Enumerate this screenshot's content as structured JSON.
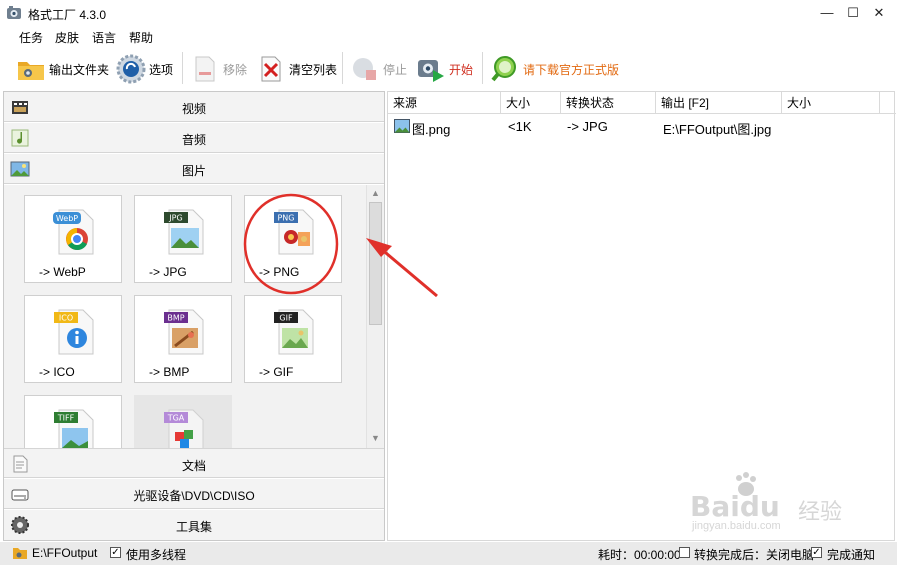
{
  "window": {
    "title": "格式工厂 4.3.0",
    "minimize_glyph": "—",
    "maximize_glyph": "☐",
    "close_glyph": "✕"
  },
  "menu": [
    "任务",
    "皮肤",
    "语言",
    "帮助"
  ],
  "toolbar": {
    "output_folder": "输出文件夹",
    "options": "选项",
    "remove": "移除",
    "clear_list": "清空列表",
    "stop": "停止",
    "start": "开始",
    "download": "请下载官方正式版"
  },
  "categories": {
    "video": "视频",
    "audio": "音频",
    "image": "图片",
    "document": "文档",
    "rom": "光驱设备\\DVD\\CD\\ISO",
    "tools": "工具集"
  },
  "formats": [
    {
      "badge": "WebP",
      "label": "-> WebP"
    },
    {
      "badge": "JPG",
      "label": "-> JPG"
    },
    {
      "badge": "PNG",
      "label": "-> PNG"
    },
    {
      "badge": "ICO",
      "label": "-> ICO"
    },
    {
      "badge": "BMP",
      "label": "-> BMP"
    },
    {
      "badge": "GIF",
      "label": "-> GIF"
    },
    {
      "badge": "TIFF",
      "label": ""
    },
    {
      "badge": "TGA",
      "label": ""
    }
  ],
  "table": {
    "headers": [
      "来源",
      "大小",
      "转换状态",
      "输出 [F2]",
      "大小"
    ],
    "rows": [
      {
        "source": "图.png",
        "size": "<1K",
        "status": "-> JPG",
        "output": "E:\\FFOutput\\图.jpg",
        "out_size": ""
      }
    ]
  },
  "statusbar": {
    "path": "E:\\FFOutput",
    "multithread": "使用多线程",
    "elapsed": "耗时：00:00:00",
    "after_convert": "转换完成后：关闭电脑",
    "notify": "完成通知"
  },
  "watermark": {
    "brand": "Baidu",
    "suffix": "经验",
    "url": "jingyan.baidu.com"
  },
  "colors": {
    "accent_red": "#e0302a",
    "download_orange": "#e26a12",
    "webp_blue": "#3b8fd6",
    "jpg_green": "#2e6e2e",
    "png_blue": "#3b6fb0",
    "ico_yellow": "#f1b816",
    "bmp_purple": "#6b2f8f",
    "gif_black": "#222222",
    "tiff_green": "#2e7d32",
    "tga_purple": "#b48ad8"
  }
}
